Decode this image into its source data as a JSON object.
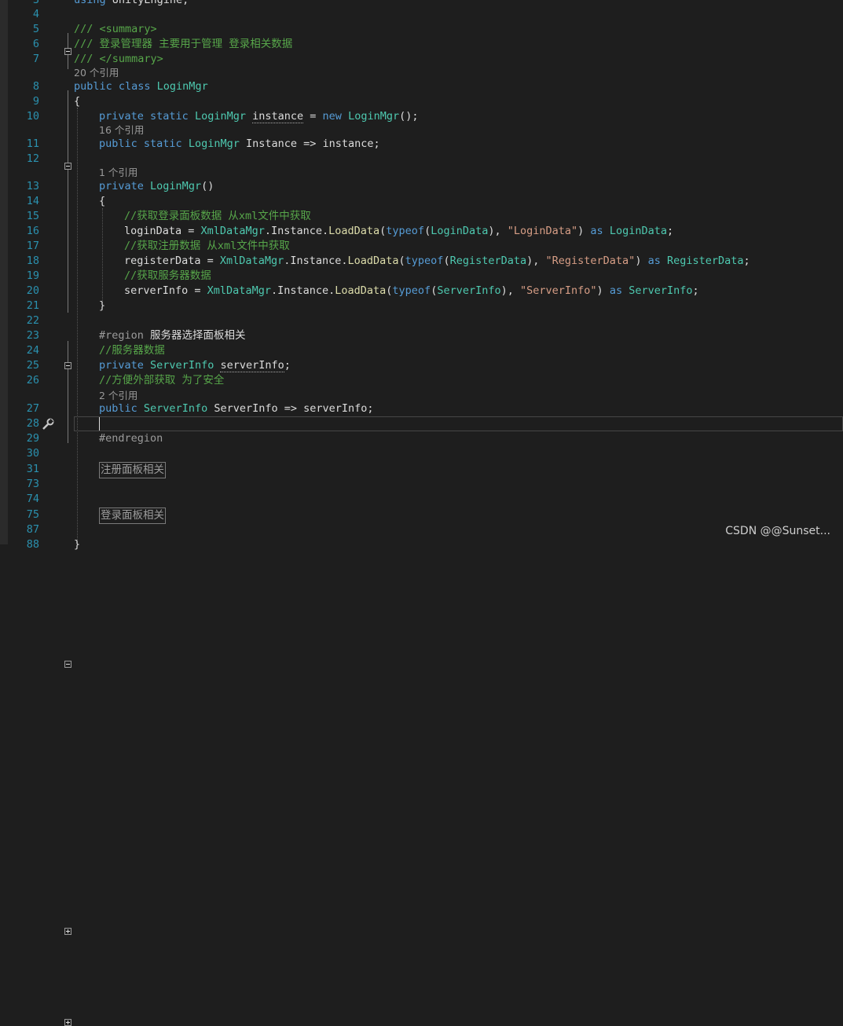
{
  "editor": {
    "lines": [
      {
        "num": "3"
      },
      {
        "num": "4"
      },
      {
        "num": "5",
        "text": "/// <summary>"
      },
      {
        "num": "6",
        "text": "/// 登录管理器 主要用于管理 登录相关数据"
      },
      {
        "num": "7",
        "text": "/// </summary>"
      },
      {
        "num": "8",
        "lens": "20 个引用",
        "kw": "public class ",
        "name": "LoginMgr"
      },
      {
        "num": "9",
        "text": "{"
      },
      {
        "num": "10"
      },
      {
        "num": "11",
        "lens": "16 个引用"
      },
      {
        "num": "12"
      },
      {
        "num": "13",
        "lens": "1 个引用"
      },
      {
        "num": "14",
        "text": "{"
      },
      {
        "num": "15",
        "text": "//获取登录面板数据 从xml文件中获取"
      },
      {
        "num": "16"
      },
      {
        "num": "17",
        "text": "//获取注册数据 从xml文件中获取"
      },
      {
        "num": "18"
      },
      {
        "num": "19",
        "text": "//获取服务器数据"
      },
      {
        "num": "20"
      },
      {
        "num": "21",
        "text": "}"
      },
      {
        "num": "22"
      },
      {
        "num": "23",
        "region": "#region ",
        "region_name": "服务器选择面板相关"
      },
      {
        "num": "24",
        "text": "//服务器数据"
      },
      {
        "num": "25"
      },
      {
        "num": "26",
        "text": "//方便外部获取 为了安全",
        "lens_after": "2 个引用"
      },
      {
        "num": "27"
      },
      {
        "num": "28"
      },
      {
        "num": "29",
        "text": "#endregion"
      },
      {
        "num": "30"
      },
      {
        "num": "31",
        "collapsed": "注册面板相关"
      },
      {
        "num": "73"
      },
      {
        "num": "74"
      },
      {
        "num": "75",
        "collapsed": "登录面板相关"
      },
      {
        "num": "87"
      },
      {
        "num": "88",
        "text": "}"
      }
    ],
    "line3_text": "using UnityEngine;"
  },
  "watermark": "CSDN @@Sunset..."
}
